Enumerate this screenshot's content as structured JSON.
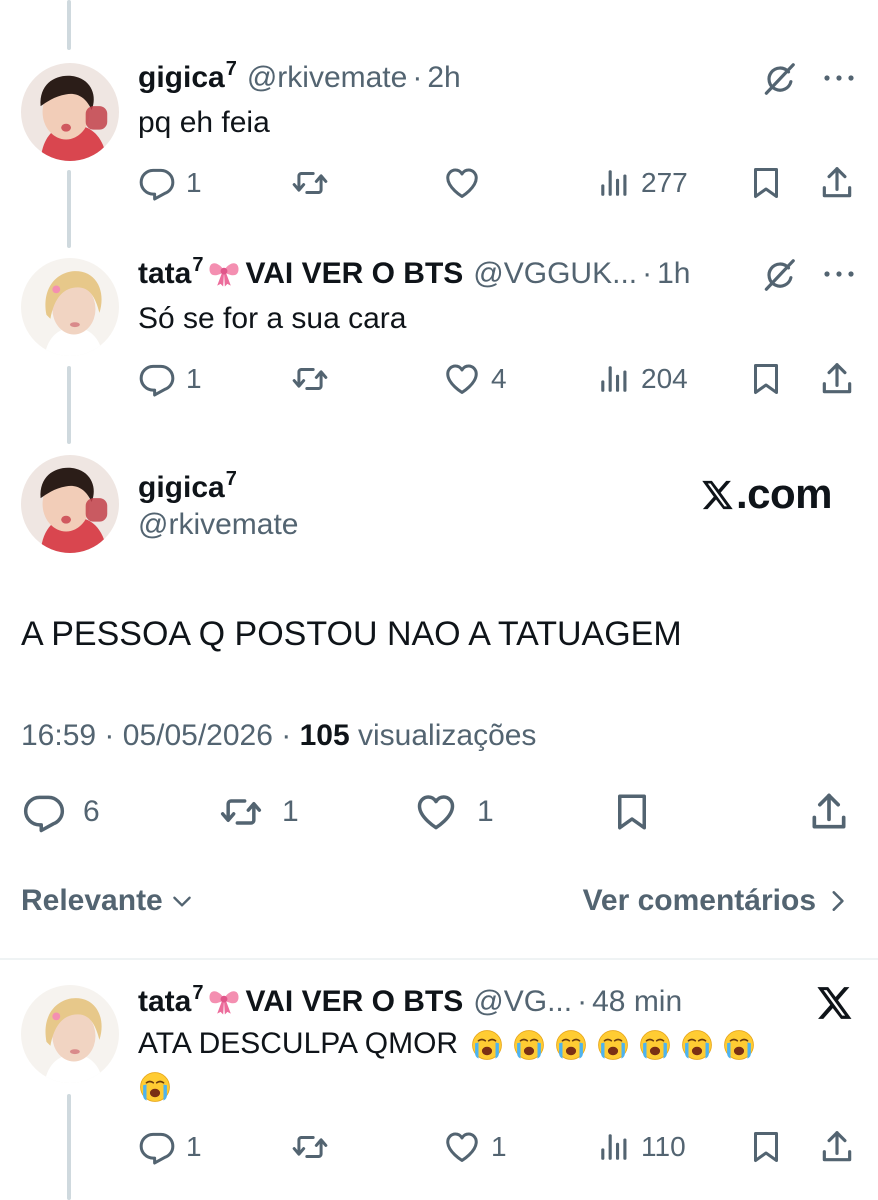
{
  "replies": [
    {
      "name": "gigica",
      "name_sup": "7",
      "handle": "@rkivemate",
      "separator": "·",
      "time": "2h",
      "text": "pq eh feia",
      "counts": {
        "reply": "1",
        "retweet": "",
        "like": "",
        "views": "277"
      }
    },
    {
      "name_prefix": "tata",
      "name_sup": "7",
      "name_suffix": "VAI VER O BTS",
      "handle": "@VGGUK...",
      "separator": "·",
      "time": "1h",
      "text": "Só se for a sua cara",
      "counts": {
        "reply": "1",
        "retweet": "",
        "like": "4",
        "views": "204"
      }
    },
    {
      "name_prefix": "tata",
      "name_sup": "7",
      "name_suffix": "VAI VER O BTS",
      "handle": "@VG...",
      "separator": "·",
      "time": "48 min",
      "text": "ATA DESCULPA QMOR",
      "emoji_count": 8,
      "counts": {
        "reply": "1",
        "retweet": "",
        "like": "1",
        "views": "110"
      }
    }
  ],
  "main": {
    "name": "gigica",
    "name_sup": "7",
    "handle": "@rkivemate",
    "brand": "X.com",
    "brand_x": "X",
    "brand_rest": ".com",
    "text": "A PESSOA Q POSTOU NAO A TATUAGEM",
    "time": "16:59",
    "date": "05/05/2026",
    "separator": "·",
    "views_count": "105",
    "views_label": "visualizações",
    "counts": {
      "reply": "6",
      "retweet": "1",
      "like": "1"
    }
  },
  "sort": {
    "label": "Relevante"
  },
  "view_replies": {
    "label": "Ver comentários"
  },
  "icons": {
    "reply": "speech-bubble-icon",
    "retweet": "retweet-icon",
    "like": "heart-icon",
    "views": "bar-chart-icon",
    "bookmark": "bookmark-icon",
    "share": "share-upload-icon",
    "grok": "grok-slash-icon",
    "more": "more-dots-icon",
    "bow": "pink-bow-emoji",
    "crying": "loudly-crying-face-emoji",
    "x_logo": "x-logo-icon"
  },
  "colors": {
    "text": "#0f1419",
    "secondary": "#536471",
    "thread_line": "#cfd9de",
    "divider": "#eff3f4"
  }
}
